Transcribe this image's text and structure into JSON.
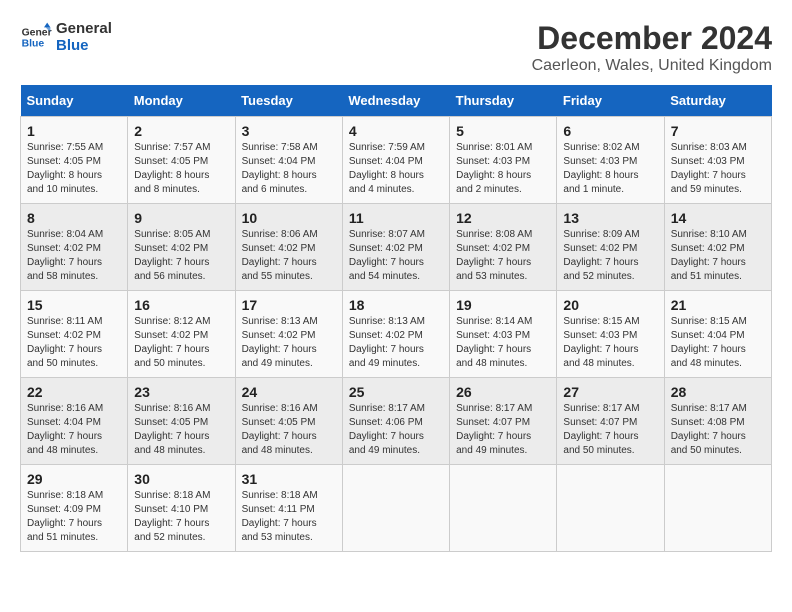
{
  "logo": {
    "line1": "General",
    "line2": "Blue"
  },
  "title": "December 2024",
  "subtitle": "Caerleon, Wales, United Kingdom",
  "days_of_week": [
    "Sunday",
    "Monday",
    "Tuesday",
    "Wednesday",
    "Thursday",
    "Friday",
    "Saturday"
  ],
  "weeks": [
    [
      {
        "day": "1",
        "sunrise": "Sunrise: 7:55 AM",
        "sunset": "Sunset: 4:05 PM",
        "daylight": "Daylight: 8 hours and 10 minutes."
      },
      {
        "day": "2",
        "sunrise": "Sunrise: 7:57 AM",
        "sunset": "Sunset: 4:05 PM",
        "daylight": "Daylight: 8 hours and 8 minutes."
      },
      {
        "day": "3",
        "sunrise": "Sunrise: 7:58 AM",
        "sunset": "Sunset: 4:04 PM",
        "daylight": "Daylight: 8 hours and 6 minutes."
      },
      {
        "day": "4",
        "sunrise": "Sunrise: 7:59 AM",
        "sunset": "Sunset: 4:04 PM",
        "daylight": "Daylight: 8 hours and 4 minutes."
      },
      {
        "day": "5",
        "sunrise": "Sunrise: 8:01 AM",
        "sunset": "Sunset: 4:03 PM",
        "daylight": "Daylight: 8 hours and 2 minutes."
      },
      {
        "day": "6",
        "sunrise": "Sunrise: 8:02 AM",
        "sunset": "Sunset: 4:03 PM",
        "daylight": "Daylight: 8 hours and 1 minute."
      },
      {
        "day": "7",
        "sunrise": "Sunrise: 8:03 AM",
        "sunset": "Sunset: 4:03 PM",
        "daylight": "Daylight: 7 hours and 59 minutes."
      }
    ],
    [
      {
        "day": "8",
        "sunrise": "Sunrise: 8:04 AM",
        "sunset": "Sunset: 4:02 PM",
        "daylight": "Daylight: 7 hours and 58 minutes."
      },
      {
        "day": "9",
        "sunrise": "Sunrise: 8:05 AM",
        "sunset": "Sunset: 4:02 PM",
        "daylight": "Daylight: 7 hours and 56 minutes."
      },
      {
        "day": "10",
        "sunrise": "Sunrise: 8:06 AM",
        "sunset": "Sunset: 4:02 PM",
        "daylight": "Daylight: 7 hours and 55 minutes."
      },
      {
        "day": "11",
        "sunrise": "Sunrise: 8:07 AM",
        "sunset": "Sunset: 4:02 PM",
        "daylight": "Daylight: 7 hours and 54 minutes."
      },
      {
        "day": "12",
        "sunrise": "Sunrise: 8:08 AM",
        "sunset": "Sunset: 4:02 PM",
        "daylight": "Daylight: 7 hours and 53 minutes."
      },
      {
        "day": "13",
        "sunrise": "Sunrise: 8:09 AM",
        "sunset": "Sunset: 4:02 PM",
        "daylight": "Daylight: 7 hours and 52 minutes."
      },
      {
        "day": "14",
        "sunrise": "Sunrise: 8:10 AM",
        "sunset": "Sunset: 4:02 PM",
        "daylight": "Daylight: 7 hours and 51 minutes."
      }
    ],
    [
      {
        "day": "15",
        "sunrise": "Sunrise: 8:11 AM",
        "sunset": "Sunset: 4:02 PM",
        "daylight": "Daylight: 7 hours and 50 minutes."
      },
      {
        "day": "16",
        "sunrise": "Sunrise: 8:12 AM",
        "sunset": "Sunset: 4:02 PM",
        "daylight": "Daylight: 7 hours and 50 minutes."
      },
      {
        "day": "17",
        "sunrise": "Sunrise: 8:13 AM",
        "sunset": "Sunset: 4:02 PM",
        "daylight": "Daylight: 7 hours and 49 minutes."
      },
      {
        "day": "18",
        "sunrise": "Sunrise: 8:13 AM",
        "sunset": "Sunset: 4:02 PM",
        "daylight": "Daylight: 7 hours and 49 minutes."
      },
      {
        "day": "19",
        "sunrise": "Sunrise: 8:14 AM",
        "sunset": "Sunset: 4:03 PM",
        "daylight": "Daylight: 7 hours and 48 minutes."
      },
      {
        "day": "20",
        "sunrise": "Sunrise: 8:15 AM",
        "sunset": "Sunset: 4:03 PM",
        "daylight": "Daylight: 7 hours and 48 minutes."
      },
      {
        "day": "21",
        "sunrise": "Sunrise: 8:15 AM",
        "sunset": "Sunset: 4:04 PM",
        "daylight": "Daylight: 7 hours and 48 minutes."
      }
    ],
    [
      {
        "day": "22",
        "sunrise": "Sunrise: 8:16 AM",
        "sunset": "Sunset: 4:04 PM",
        "daylight": "Daylight: 7 hours and 48 minutes."
      },
      {
        "day": "23",
        "sunrise": "Sunrise: 8:16 AM",
        "sunset": "Sunset: 4:05 PM",
        "daylight": "Daylight: 7 hours and 48 minutes."
      },
      {
        "day": "24",
        "sunrise": "Sunrise: 8:16 AM",
        "sunset": "Sunset: 4:05 PM",
        "daylight": "Daylight: 7 hours and 48 minutes."
      },
      {
        "day": "25",
        "sunrise": "Sunrise: 8:17 AM",
        "sunset": "Sunset: 4:06 PM",
        "daylight": "Daylight: 7 hours and 49 minutes."
      },
      {
        "day": "26",
        "sunrise": "Sunrise: 8:17 AM",
        "sunset": "Sunset: 4:07 PM",
        "daylight": "Daylight: 7 hours and 49 minutes."
      },
      {
        "day": "27",
        "sunrise": "Sunrise: 8:17 AM",
        "sunset": "Sunset: 4:07 PM",
        "daylight": "Daylight: 7 hours and 50 minutes."
      },
      {
        "day": "28",
        "sunrise": "Sunrise: 8:17 AM",
        "sunset": "Sunset: 4:08 PM",
        "daylight": "Daylight: 7 hours and 50 minutes."
      }
    ],
    [
      {
        "day": "29",
        "sunrise": "Sunrise: 8:18 AM",
        "sunset": "Sunset: 4:09 PM",
        "daylight": "Daylight: 7 hours and 51 minutes."
      },
      {
        "day": "30",
        "sunrise": "Sunrise: 8:18 AM",
        "sunset": "Sunset: 4:10 PM",
        "daylight": "Daylight: 7 hours and 52 minutes."
      },
      {
        "day": "31",
        "sunrise": "Sunrise: 8:18 AM",
        "sunset": "Sunset: 4:11 PM",
        "daylight": "Daylight: 7 hours and 53 minutes."
      },
      null,
      null,
      null,
      null
    ]
  ]
}
